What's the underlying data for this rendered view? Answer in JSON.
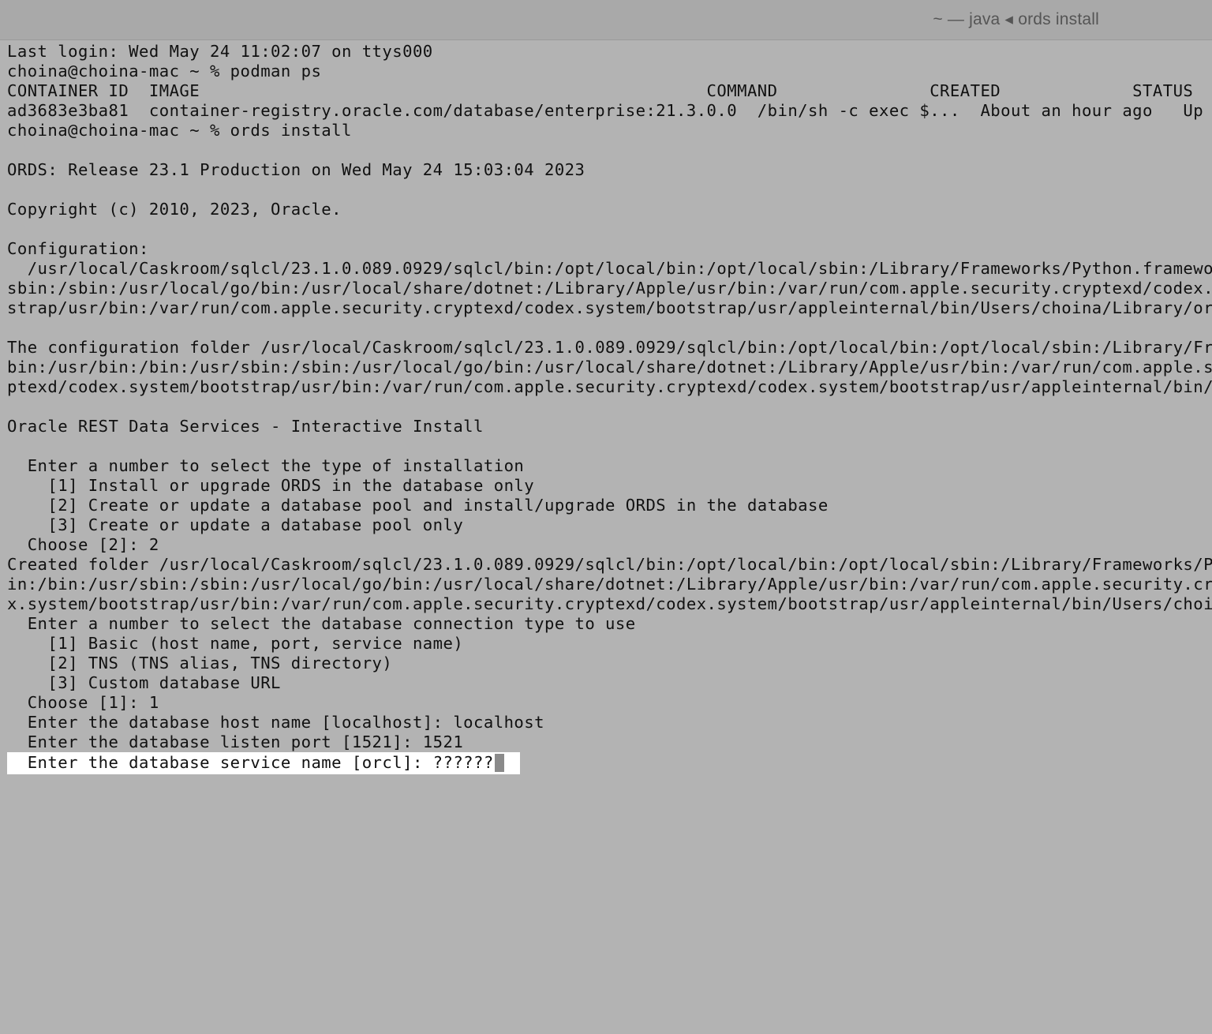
{
  "window": {
    "title": "~ — java ◂ ords install"
  },
  "terminal": {
    "lines": [
      "Last login: Wed May 24 11:02:07 on ttys000",
      "choina@choina-mac ~ % podman ps",
      "CONTAINER ID  IMAGE                                                  COMMAND               CREATED             STATUS",
      "ad3683e3ba81  container-registry.oracle.com/database/enterprise:21.3.0.0  /bin/sh -c exec $...  About an hour ago   Up About",
      "choina@choina-mac ~ % ords install",
      "",
      "ORDS: Release 23.1 Production on Wed May 24 15:03:04 2023",
      "",
      "Copyright (c) 2010, 2023, Oracle.",
      "",
      "Configuration:",
      "  /usr/local/Caskroom/sqlcl/23.1.0.089.0929/sqlcl/bin:/opt/local/bin:/opt/local/sbin:/Library/Frameworks/Python.framework/V",
      "sbin:/sbin:/usr/local/go/bin:/usr/local/share/dotnet:/Library/Apple/usr/bin:/var/run/com.apple.security.cryptexd/codex.sys",
      "strap/usr/bin:/var/run/com.apple.security.cryptexd/codex.system/bootstrap/usr/appleinternal/bin/Users/choina/Library/ords_",
      "",
      "The configuration folder /usr/local/Caskroom/sqlcl/23.1.0.089.0929/sqlcl/bin:/opt/local/bin:/opt/local/sbin:/Library/Frame",
      "bin:/usr/bin:/bin:/usr/sbin:/sbin:/usr/local/go/bin:/usr/local/share/dotnet:/Library/Apple/usr/bin:/var/run/com.apple.secu",
      "ptexd/codex.system/bootstrap/usr/bin:/var/run/com.apple.security.cryptexd/codex.system/bootstrap/usr/appleinternal/bin/Use",
      "",
      "Oracle REST Data Services - Interactive Install",
      "",
      "  Enter a number to select the type of installation",
      "    [1] Install or upgrade ORDS in the database only",
      "    [2] Create or update a database pool and install/upgrade ORDS in the database",
      "    [3] Create or update a database pool only",
      "  Choose [2]: 2",
      "Created folder /usr/local/Caskroom/sqlcl/23.1.0.089.0929/sqlcl/bin:/opt/local/bin:/opt/local/sbin:/Library/Frameworks/Pytho",
      "in:/bin:/usr/sbin:/sbin:/usr/local/go/bin:/usr/local/share/dotnet:/Library/Apple/usr/bin:/var/run/com.apple.security.crypte",
      "x.system/bootstrap/usr/bin:/var/run/com.apple.security.cryptexd/codex.system/bootstrap/usr/appleinternal/bin/Users/choina/",
      "  Enter a number to select the database connection type to use",
      "    [1] Basic (host name, port, service name)",
      "    [2] TNS (TNS alias, TNS directory)",
      "    [3] Custom database URL",
      "  Choose [1]: 1",
      "  Enter the database host name [localhost]: localhost",
      "  Enter the database listen port [1521]: 1521"
    ],
    "current_input_line": "  Enter the database service name [orcl]: ??????"
  }
}
